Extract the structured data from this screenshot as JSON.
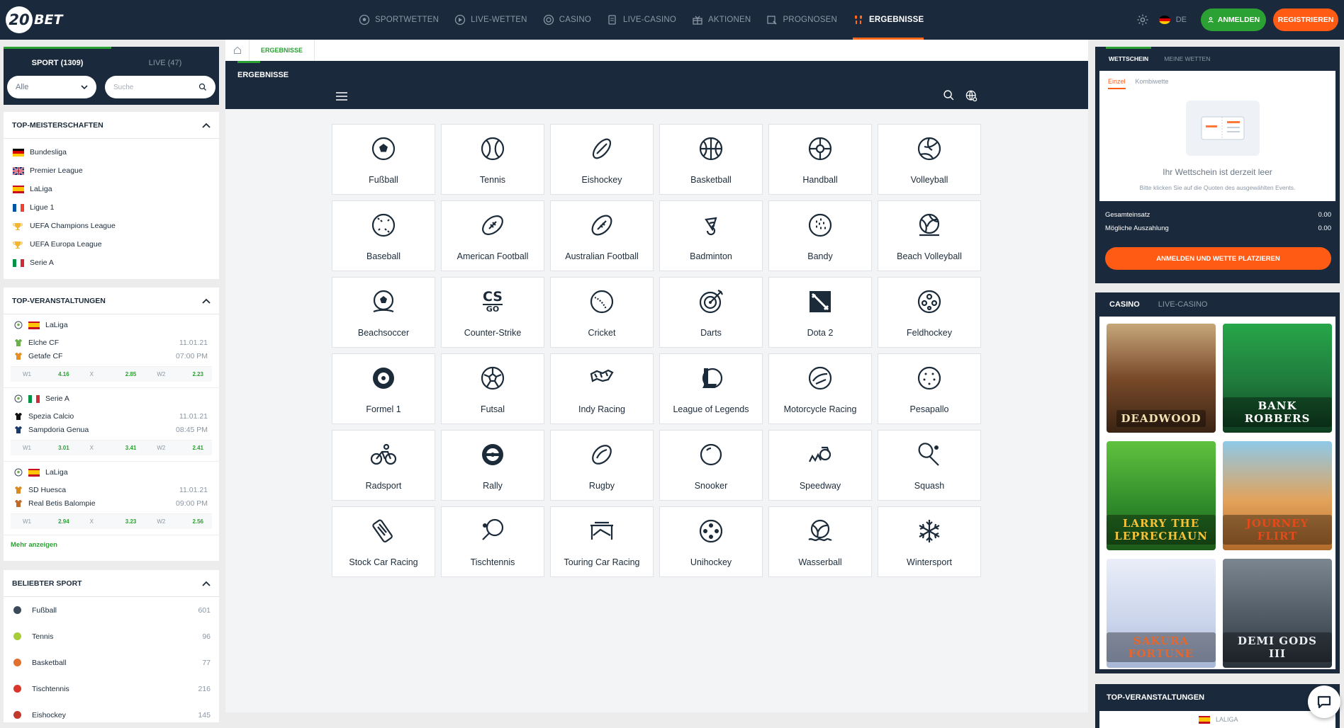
{
  "brand": {
    "logo_num": "20",
    "logo_text": "BET"
  },
  "nav": {
    "items": [
      {
        "label": "SPORTWETTEN",
        "icon": "soccer-ball-icon"
      },
      {
        "label": "LIVE-WETTEN",
        "icon": "live-icon"
      },
      {
        "label": "CASINO",
        "icon": "casino-chip-icon"
      },
      {
        "label": "LIVE-CASINO",
        "icon": "live-casino-icon"
      },
      {
        "label": "AKTIONEN",
        "icon": "gift-icon"
      },
      {
        "label": "PROGNOSEN",
        "icon": "prognosis-icon"
      },
      {
        "label": "ERGEBNISSE",
        "icon": "trophy-icon",
        "active": true
      }
    ],
    "lang": "DE",
    "login": "ANMELDEN",
    "register": "REGISTRIEREN"
  },
  "left": {
    "tabs": [
      "SPORT (1309)",
      "LIVE (47)"
    ],
    "filter_value": "Alle",
    "search_placeholder": "Suche",
    "top_leagues_title": "TOP-MEISTERSCHAFTEN",
    "top_leagues": [
      "Bundesliga",
      "Premier League",
      "LaLiga",
      "Ligue 1",
      "UEFA Champions League",
      "UEFA Europa League",
      "Serie A"
    ],
    "top_events_title": "TOP-VERANSTALTUNGEN",
    "events": [
      {
        "league": "LaLiga",
        "home": "Elche CF",
        "away": "Getafe CF",
        "date": "11.01.21",
        "time": "07:00 PM",
        "w1": "4.16",
        "x": "2.85",
        "w2": "2.23"
      },
      {
        "league": "Serie A",
        "home": "Spezia Calcio",
        "away": "Sampdoria Genua",
        "date": "11.01.21",
        "time": "08:45 PM",
        "w1": "3.01",
        "x": "3.41",
        "w2": "2.41"
      },
      {
        "league": "LaLiga",
        "home": "SD Huesca",
        "away": "Real Betis Balompie",
        "date": "11.01.21",
        "time": "09:00 PM",
        "w1": "2.94",
        "x": "3.23",
        "w2": "2.56"
      }
    ],
    "odds_labels": {
      "w1": "W1",
      "x": "X",
      "w2": "W2"
    },
    "more": "Mehr anzeigen",
    "popular_title": "BELIEBTER SPORT",
    "popular": [
      {
        "name": "Fußball",
        "count": "601",
        "color": "#3b4a5a"
      },
      {
        "name": "Tennis",
        "count": "96",
        "color": "#a8cc3a"
      },
      {
        "name": "Basketball",
        "count": "77",
        "color": "#e0702c"
      },
      {
        "name": "Tischtennis",
        "count": "216",
        "color": "#d9352b"
      },
      {
        "name": "Eishockey",
        "count": "145",
        "color": "#c0392b"
      }
    ]
  },
  "center": {
    "breadcrumb": "ERGEBNISSE",
    "title": "ERGEBNISSE",
    "sports": [
      "Fußball",
      "Tennis",
      "Eishockey",
      "Basketball",
      "Handball",
      "Volleyball",
      "Baseball",
      "American Football",
      "Australian Football",
      "Badminton",
      "Bandy",
      "Beach Volleyball",
      "Beachsoccer",
      "Counter-Strike",
      "Cricket",
      "Darts",
      "Dota 2",
      "Feldhockey",
      "Formel 1",
      "Futsal",
      "Indy Racing",
      "League of Legends",
      "Motorcycle Racing",
      "Pesapallo",
      "Radsport",
      "Rally",
      "Rugby",
      "Snooker",
      "Speedway",
      "Squash",
      "Stock Car Racing",
      "Tischtennis",
      "Touring Car Racing",
      "Unihockey",
      "Wasserball",
      "Wintersport"
    ],
    "cs_logo": [
      "CS",
      "GO"
    ]
  },
  "betslip": {
    "tabs": [
      "WETTSCHEIN",
      "MEINE WETTEN"
    ],
    "subtabs": [
      "Einzel",
      "Kombiwette"
    ],
    "empty": "Ihr Wettschein ist derzeit leer",
    "hint": "Bitte klicken Sie auf die Quoten des ausgewählten Events.",
    "stake_label": "Gesamteinsatz",
    "stake": "0.00",
    "payout_label": "Mögliche Auszahlung",
    "payout": "0.00",
    "cta": "ANMELDEN UND WETTE PLATZIEREN"
  },
  "casino": {
    "tabs": [
      "CASINO",
      "LIVE-CASINO"
    ],
    "games": [
      {
        "title": "DEADWOOD",
        "bg": "#5a3a22"
      },
      {
        "title": "BANK ROBBERS",
        "bg": "#1f7a3c"
      },
      {
        "title": "LARRY THE LEPRECHAUN",
        "bg": "#2f8a2a"
      },
      {
        "title": "JOURNEY FLIRT",
        "bg": "#d28a3a"
      },
      {
        "title": "SAKURA FORTUNE",
        "bg": "#c9d3ea"
      },
      {
        "title": "DEMI GODS III",
        "bg": "#4a5560"
      }
    ]
  },
  "right_events_title": "TOP-VERANSTALTUNGEN",
  "right_events_sub": "LALIGA",
  "colors": {
    "navy": "#1a2a3c",
    "green": "#2aa132",
    "orange": "#ff5b14"
  }
}
